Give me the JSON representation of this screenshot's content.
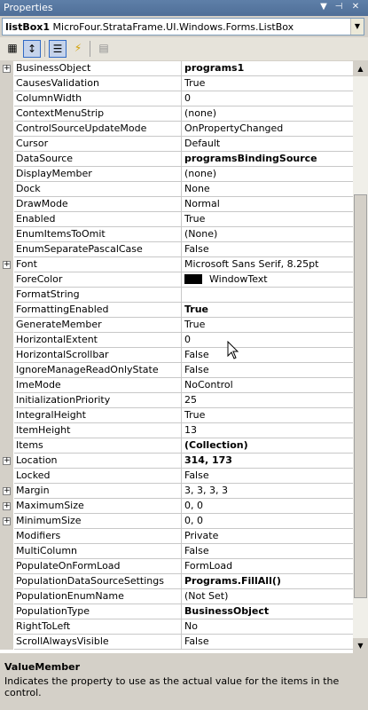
{
  "window": {
    "title": "Properties"
  },
  "object_selector": {
    "name": "listBox1",
    "type": "MicroFour.StrataFrame.UI.Windows.Forms.ListBox"
  },
  "description": {
    "title": "ValueMember",
    "text": "Indicates the property to use as the actual value for the items in the control."
  },
  "colors": {
    "titlebar": "#5e7fa8",
    "grid_lines": "#c8c8c8",
    "gutter": "#d4d0c8"
  },
  "properties": [
    {
      "name": "BusinessObject",
      "value": "programs1",
      "bold": true,
      "expandable": true
    },
    {
      "name": "CausesValidation",
      "value": "True"
    },
    {
      "name": "ColumnWidth",
      "value": "0"
    },
    {
      "name": "ContextMenuStrip",
      "value": "(none)"
    },
    {
      "name": "ControlSourceUpdateMode",
      "value": "OnPropertyChanged"
    },
    {
      "name": "Cursor",
      "value": "Default"
    },
    {
      "name": "DataSource",
      "value": "programsBindingSource",
      "bold": true
    },
    {
      "name": "DisplayMember",
      "value": "(none)"
    },
    {
      "name": "Dock",
      "value": "None"
    },
    {
      "name": "DrawMode",
      "value": "Normal"
    },
    {
      "name": "Enabled",
      "value": "True"
    },
    {
      "name": "EnumItemsToOmit",
      "value": "(None)"
    },
    {
      "name": "EnumSeparatePascalCase",
      "value": "False"
    },
    {
      "name": "Font",
      "value": "Microsoft Sans Serif, 8.25pt",
      "expandable": true
    },
    {
      "name": "ForeColor",
      "value": "WindowText",
      "swatch": "#000000"
    },
    {
      "name": "FormatString",
      "value": ""
    },
    {
      "name": "FormattingEnabled",
      "value": "True",
      "bold": true
    },
    {
      "name": "GenerateMember",
      "value": "True"
    },
    {
      "name": "HorizontalExtent",
      "value": "0"
    },
    {
      "name": "HorizontalScrollbar",
      "value": "False"
    },
    {
      "name": "IgnoreManageReadOnlyState",
      "value": "False"
    },
    {
      "name": "ImeMode",
      "value": "NoControl"
    },
    {
      "name": "InitializationPriority",
      "value": "25"
    },
    {
      "name": "IntegralHeight",
      "value": "True"
    },
    {
      "name": "ItemHeight",
      "value": "13"
    },
    {
      "name": "Items",
      "value": "(Collection)",
      "bold": true
    },
    {
      "name": "Location",
      "value": "314, 173",
      "bold": true,
      "expandable": true
    },
    {
      "name": "Locked",
      "value": "False"
    },
    {
      "name": "Margin",
      "value": "3, 3, 3, 3",
      "expandable": true
    },
    {
      "name": "MaximumSize",
      "value": "0, 0",
      "expandable": true
    },
    {
      "name": "MinimumSize",
      "value": "0, 0",
      "expandable": true
    },
    {
      "name": "Modifiers",
      "value": "Private"
    },
    {
      "name": "MultiColumn",
      "value": "False"
    },
    {
      "name": "PopulateOnFormLoad",
      "value": "FormLoad"
    },
    {
      "name": "PopulationDataSourceSettings",
      "value": "Programs.FillAll()",
      "bold": true
    },
    {
      "name": "PopulationEnumName",
      "value": "(Not Set)"
    },
    {
      "name": "PopulationType",
      "value": "BusinessObject",
      "bold": true
    },
    {
      "name": "RightToLeft",
      "value": "No"
    },
    {
      "name": "ScrollAlwaysVisible",
      "value": "False"
    }
  ]
}
